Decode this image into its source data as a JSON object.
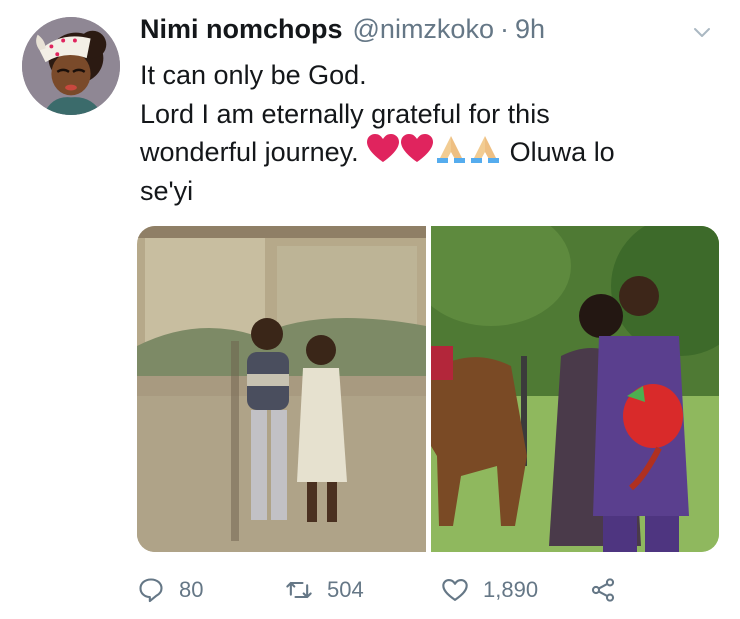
{
  "tweet": {
    "display_name": "Nimi nomchops",
    "handle": "@nimzkoko",
    "separator": "·",
    "time": "9h",
    "text_lines": [
      "It can only be God.",
      "Lord I am eternally grateful for this",
      "wonderful journey.",
      "Oluwa lo",
      "se'yi"
    ],
    "emojis": [
      "red-heart",
      "red-heart",
      "folded-hands",
      "folded-hands"
    ]
  },
  "media": {
    "left_photo": "childhood photo of a boy and a girl",
    "right_photo": "couple with a horse holding red flowers"
  },
  "actions": {
    "reply_count": "80",
    "retweet_count": "504",
    "like_count": "1,890"
  },
  "colors": {
    "text": "#14171a",
    "secondary": "#657786",
    "heart": "#e0245e",
    "avatar_bg": "#8f8794"
  }
}
